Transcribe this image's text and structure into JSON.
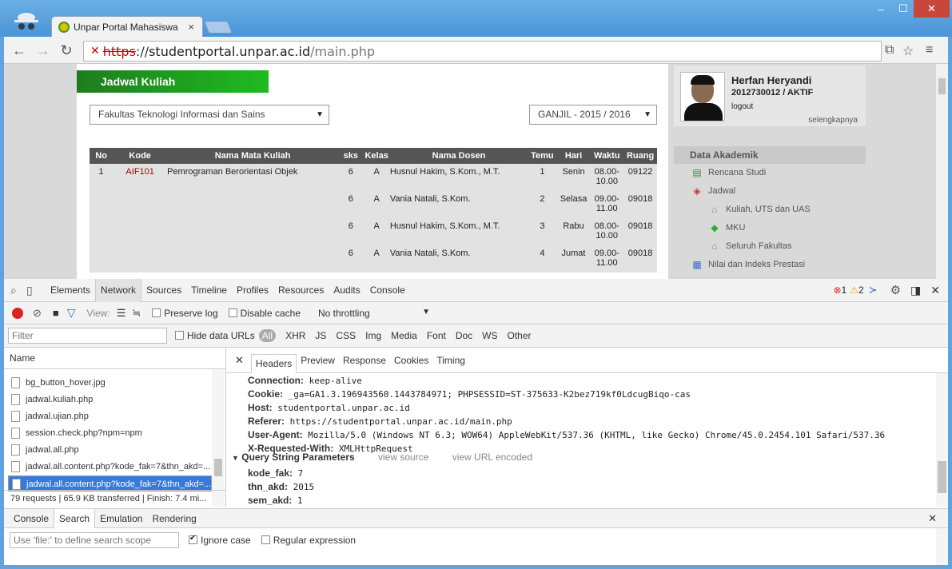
{
  "browser": {
    "tab_title": "Unpar Portal Mahasiswa",
    "tab_close": "×",
    "url_protocol": "https",
    "url_separator": "://",
    "url_host": "studentportal.unpar.ac.id",
    "url_path": "/main.php",
    "window_controls": [
      "–",
      "☐",
      "✕"
    ]
  },
  "page": {
    "header": "Jadwal Kuliah",
    "faculty_select": "Fakultas Teknologi Informasi dan Sains",
    "semester_select": "GANJIL - 2015 / 2016",
    "table": {
      "columns": [
        "No",
        "Kode",
        "Nama Mata Kuliah",
        "sks",
        "Kelas",
        "Nama Dosen",
        "Temu",
        "Hari",
        "Waktu",
        "Ruang"
      ],
      "rows": [
        {
          "no": "1",
          "kode": "AIF101",
          "nama": "Pemrograman Berorientasi Objek",
          "sks": "6",
          "kelas": "A",
          "dosen": "Husnul Hakim, S.Kom., M.T.",
          "temu": "1",
          "hari": "Senin",
          "waktu": "08.00-10.00",
          "ruang": "09122"
        },
        {
          "no": "",
          "kode": "",
          "nama": "",
          "sks": "6",
          "kelas": "A",
          "dosen": "Vania Natali, S.Kom.",
          "temu": "2",
          "hari": "Selasa",
          "waktu": "09.00-11.00",
          "ruang": "09018"
        },
        {
          "no": "",
          "kode": "",
          "nama": "",
          "sks": "6",
          "kelas": "A",
          "dosen": "Husnul Hakim, S.Kom., M.T.",
          "temu": "3",
          "hari": "Rabu",
          "waktu": "08.00-10.00",
          "ruang": "09018"
        },
        {
          "no": "",
          "kode": "",
          "nama": "",
          "sks": "6",
          "kelas": "A",
          "dosen": "Vania Natali, S.Kom.",
          "temu": "4",
          "hari": "Jumat",
          "waktu": "09.00-11.00",
          "ruang": "09018"
        }
      ]
    },
    "profile": {
      "name": "Herfan Heryandi",
      "id_status": "2012730012 / AKTIF",
      "logout": "logout",
      "more": "selengkapnya"
    },
    "sidebar": {
      "heading": "Data Akademik",
      "items": [
        "Rencana Studi",
        "Jadwal",
        "Kuliah, UTS dan UAS",
        "MKU",
        "Seluruh Fakultas",
        "Nilai dan Indeks Prestasi"
      ]
    }
  },
  "devtools": {
    "tabs": [
      "Elements",
      "Network",
      "Sources",
      "Timeline",
      "Profiles",
      "Resources",
      "Audits",
      "Console"
    ],
    "errors": "1",
    "warnings": "2",
    "view_label": "View:",
    "preserve_log": "Preserve log",
    "disable_cache": "Disable cache",
    "throttling": "No throttling",
    "filter_placeholder": "Filter",
    "hide_data_urls": "Hide data URLs",
    "type_filters": [
      "All",
      "XHR",
      "JS",
      "CSS",
      "Img",
      "Media",
      "Font",
      "Doc",
      "WS",
      "Other"
    ],
    "list_header": "Name",
    "requests": [
      "bg_button_hover.jpg",
      "jadwal.kuliah.php",
      "jadwal.ujian.php",
      "session.check.php?npm=npm",
      "jadwal.all.php",
      "jadwal.all.content.php?kode_fak=7&thn_akd=...",
      "jadwal.all.content.php?kode_fak=7&thn_akd=..."
    ],
    "status": "79 requests  |  65.9 KB transferred  |  Finish: 7.4 mi...",
    "detail_tabs": [
      "Headers",
      "Preview",
      "Response",
      "Cookies",
      "Timing"
    ],
    "headers": [
      {
        "k": "Connection:",
        "v": "keep-alive"
      },
      {
        "k": "Cookie:",
        "v": "_ga=GA1.3.196943560.1443784971; PHPSESSID=ST-375633-K2bez719kf0LdcugBiqo-cas"
      },
      {
        "k": "Host:",
        "v": "studentportal.unpar.ac.id"
      },
      {
        "k": "Referer:",
        "v": "https://studentportal.unpar.ac.id/main.php"
      },
      {
        "k": "User-Agent:",
        "v": "Mozilla/5.0 (Windows NT 6.3; WOW64) AppleWebKit/537.36 (KHTML, like Gecko) Chrome/45.0.2454.101 Safari/537.36"
      },
      {
        "k": "X-Requested-With:",
        "v": "XMLHttpRequest"
      }
    ],
    "qsp_title": "Query String Parameters",
    "view_source": "view source",
    "view_url_encoded": "view URL encoded",
    "params": [
      {
        "k": "kode_fak:",
        "v": "7"
      },
      {
        "k": "thn_akd:",
        "v": "2015"
      },
      {
        "k": "sem_akd:",
        "v": "1"
      }
    ],
    "drawer_tabs": [
      "Console",
      "Search",
      "Emulation",
      "Rendering"
    ],
    "search_placeholder": "Use 'file:' to define search scope",
    "ignore_case": "Ignore case",
    "regex": "Regular expression"
  }
}
